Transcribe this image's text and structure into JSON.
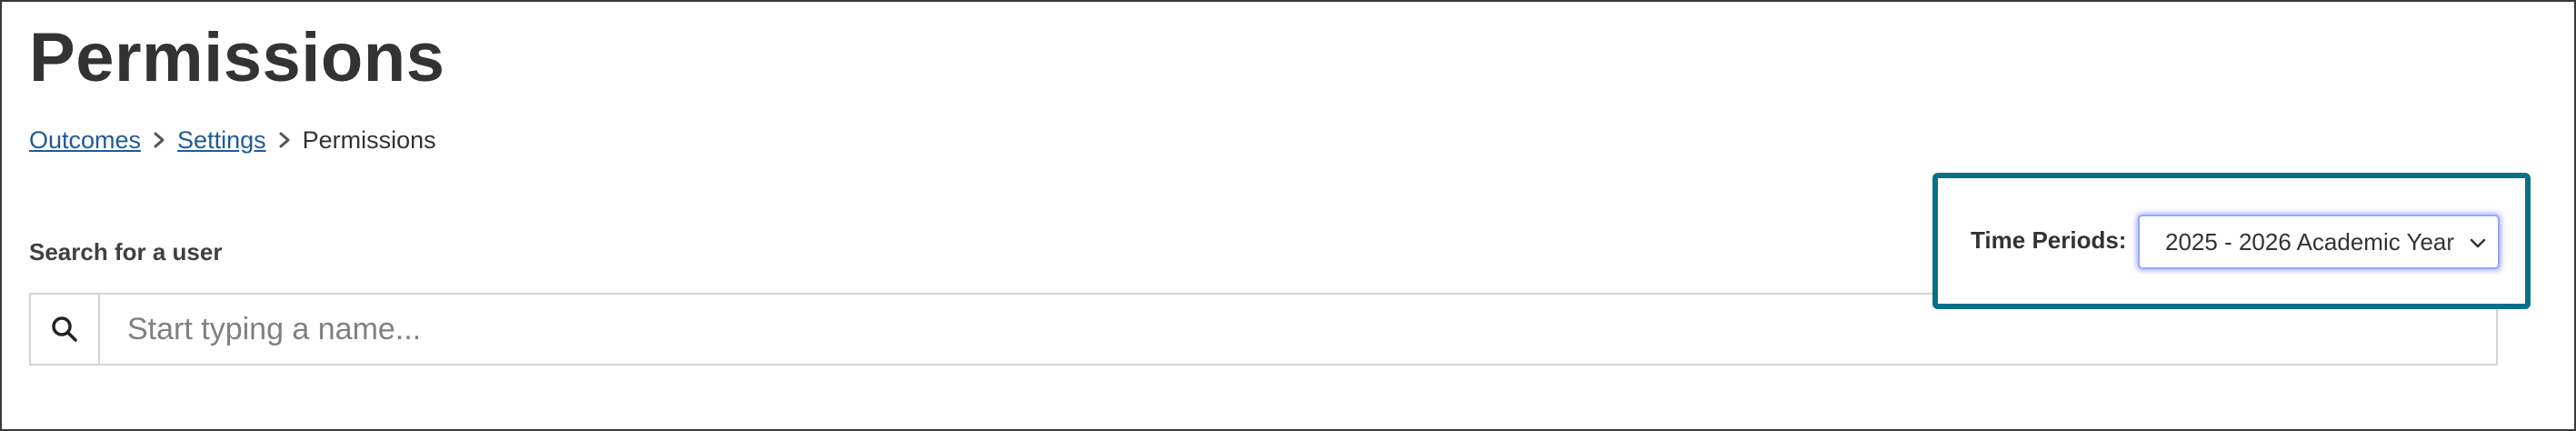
{
  "page": {
    "title": "Permissions"
  },
  "breadcrumb": {
    "items": [
      {
        "label": "Outcomes",
        "link": true
      },
      {
        "label": "Settings",
        "link": true
      },
      {
        "label": "Permissions",
        "link": false
      }
    ],
    "separator_icon": "chevron-right-icon"
  },
  "search": {
    "label": "Search for a user",
    "placeholder": "Start typing a name...",
    "value": "",
    "icon": "search-icon"
  },
  "time_periods": {
    "label": "Time Periods:",
    "selected": "2025 - 2026 Academic Year",
    "dropdown_icon": "chevron-down-icon"
  },
  "colors": {
    "link": "#1f5b99",
    "highlight_border": "#0a7086",
    "focus_ring": "#9aa6ff",
    "text": "#333333"
  }
}
